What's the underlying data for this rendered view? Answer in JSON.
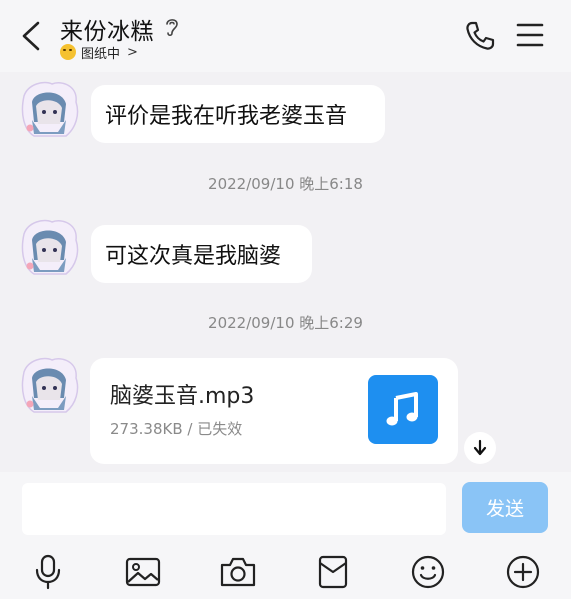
{
  "header": {
    "title": "来份冰糕",
    "status_text": "图纸中",
    "status_chevron": ">"
  },
  "messages": [
    {
      "text": "评价是我在听我老婆玉音"
    },
    {
      "timestamp": "2022/09/10 晚上6:18"
    },
    {
      "text": "可这次真是我脑婆"
    },
    {
      "timestamp": "2022/09/10 晚上6:29"
    }
  ],
  "file": {
    "name": "脑婆玉音.mp3",
    "meta": "273.38KB / 已失效",
    "icon": "music-note-icon",
    "icon_color": "#1e8ff0"
  },
  "composer": {
    "input_value": "",
    "send_label": "发送",
    "send_color": "#8ac4f6"
  },
  "toolbar": {
    "icons": [
      "microphone-icon",
      "image-icon",
      "camera-icon",
      "red-packet-icon",
      "emoji-icon",
      "plus-icon"
    ]
  }
}
